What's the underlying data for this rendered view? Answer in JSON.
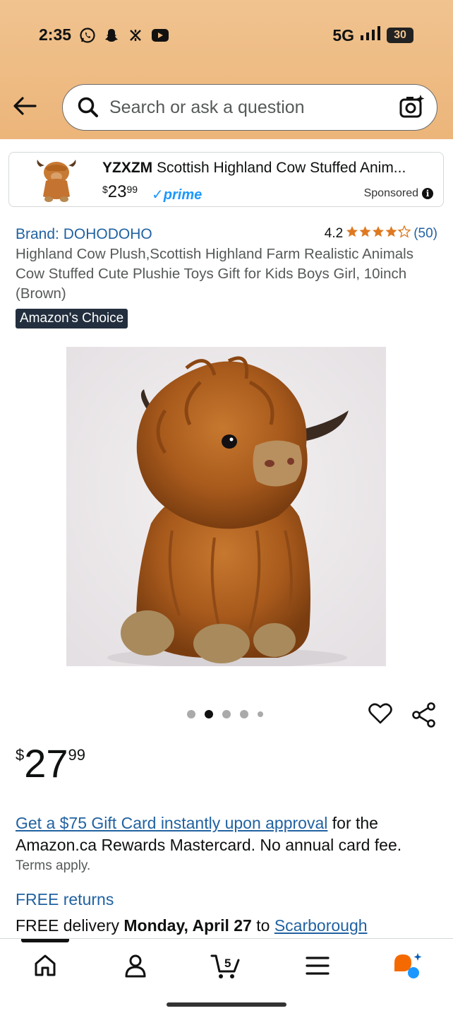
{
  "status_bar": {
    "time": "2:35",
    "network": "5G",
    "battery": "30"
  },
  "search": {
    "placeholder": "Search or ask a question"
  },
  "sponsored": {
    "brand": "YZXZM",
    "title": "Scottish Highland Cow Stuffed Anim...",
    "price_symbol": "$",
    "price_whole": "23",
    "price_fraction": "99",
    "prime_label": "prime",
    "label": "Sponsored"
  },
  "product": {
    "brand": "Brand: DOHODOHO",
    "rating_value": "4.2",
    "rating_stars": 4.2,
    "rating_count": "(50)",
    "title": "Highland Cow Plush,Scottish Highland Farm Realistic Animals Cow Stuffed Cute Plushie Toys Gift for Kids Boys Girl, 10inch (Brown)",
    "badge": "Amazon's Choice",
    "image_count": 5,
    "active_image": 2,
    "price_symbol": "$",
    "price_whole": "27",
    "price_fraction": "99"
  },
  "offer": {
    "link_text": "Get a $75 Gift Card instantly upon approval",
    "text": " for the Amazon.ca Rewards Mastercard. No annual card fee.",
    "terms": "Terms apply."
  },
  "delivery": {
    "free_returns": "FREE returns",
    "prefix": "FREE delivery ",
    "date": "Monday, April 27",
    "to": " to ",
    "location": "Scarborough"
  },
  "bottom_nav": {
    "cart_count": "5",
    "items": [
      "home-icon",
      "account-icon",
      "cart-icon",
      "menu-icon",
      "rufus-icon"
    ]
  },
  "colors": {
    "header_bg": "#ecb57a",
    "link": "#2162a1",
    "star": "#de7921",
    "badge_bg": "#232f3e",
    "prime": "#1a98ff"
  }
}
